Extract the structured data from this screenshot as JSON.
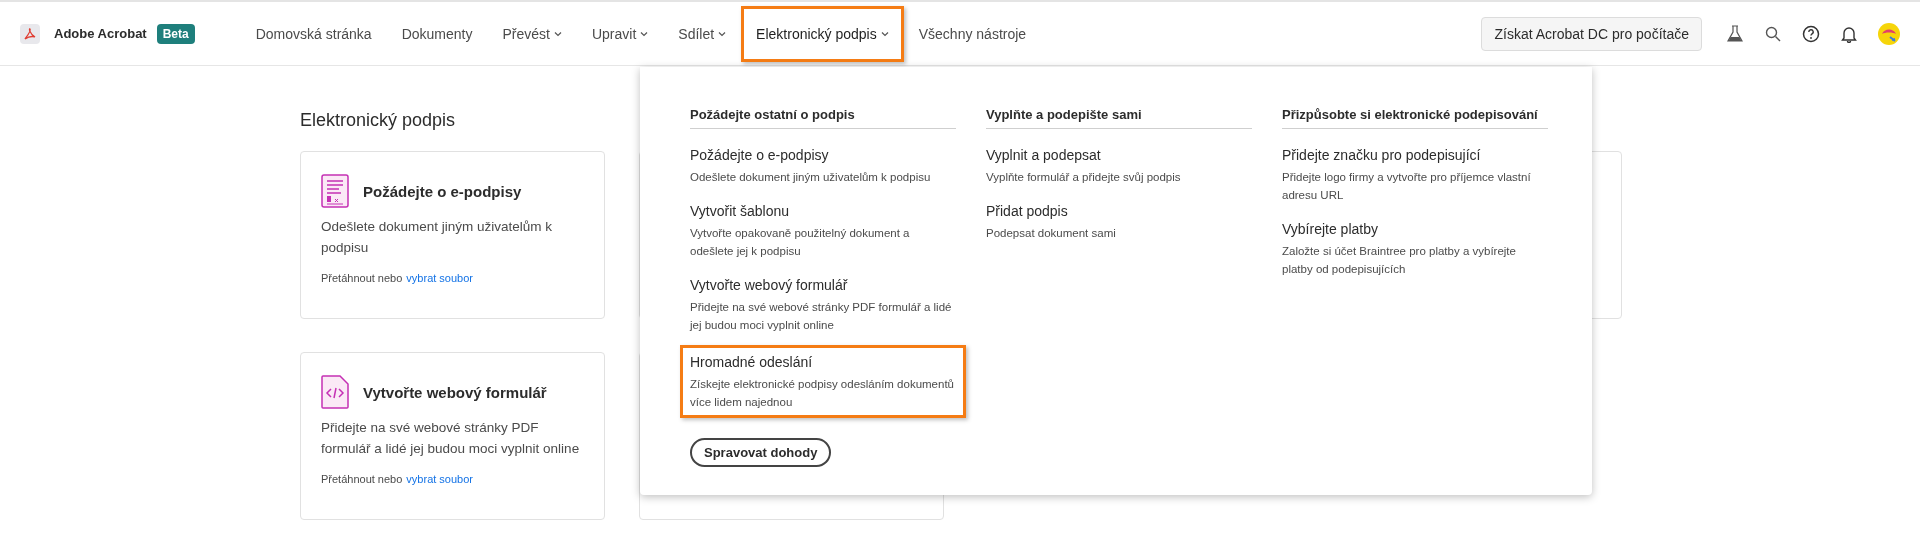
{
  "app": {
    "name": "Adobe Acrobat",
    "badge": "Beta"
  },
  "nav": [
    {
      "label": "Domovská stránka",
      "has_menu": false,
      "selected": false,
      "highlighted": false
    },
    {
      "label": "Dokumenty",
      "has_menu": false,
      "selected": false,
      "highlighted": false
    },
    {
      "label": "Převést",
      "has_menu": true,
      "selected": false,
      "highlighted": false
    },
    {
      "label": "Upravit",
      "has_menu": true,
      "selected": false,
      "highlighted": false
    },
    {
      "label": "Sdílet",
      "has_menu": true,
      "selected": false,
      "highlighted": false
    },
    {
      "label": "Elektronický podpis",
      "has_menu": true,
      "selected": true,
      "highlighted": true
    },
    {
      "label": "Všechny nástroje",
      "has_menu": false,
      "selected": false,
      "highlighted": false
    }
  ],
  "get_desktop_button": "Získat Acrobat DC pro počítače",
  "page_title": "Elektronický podpis",
  "cards": [
    {
      "kind": "sign",
      "title": "Požádejte o e-podpisy",
      "description": "Odešlete dokument jiným uživatelům k podpisu",
      "drop_text": "Přetáhnout nebo",
      "link": "vybrat soubor"
    },
    {
      "kind": "code",
      "title": "Vytvořte webový formulář",
      "description": "Přidejte na své webové stránky PDF formulář a lidé jej budou moci vyplnit online",
      "drop_text": "Přetáhnout nebo",
      "link": "vybrat soubor"
    }
  ],
  "menu": {
    "columns": [
      {
        "header": "Požádejte ostatní o podpis",
        "items": [
          {
            "title": "Požádejte o e-podpisy",
            "description": "Odešlete dokument jiným uživatelům k podpisu",
            "highlighted": false
          },
          {
            "title": "Vytvořit šablonu",
            "description": "Vytvořte opakovaně použitelný dokument a odešlete jej k podpisu",
            "highlighted": false
          },
          {
            "title": "Vytvořte webový formulář",
            "description": "Přidejte na své webové stránky PDF formulář a lidé jej budou moci vyplnit online",
            "highlighted": false
          },
          {
            "title": "Hromadné odeslání",
            "description": "Získejte elektronické podpisy odesláním dokumentů více lidem najednou",
            "highlighted": true
          }
        ],
        "button": "Spravovat dohody"
      },
      {
        "header": "Vyplňte a podepište sami",
        "items": [
          {
            "title": "Vyplnit a podepsat",
            "description": "Vyplňte formulář a přidejte svůj podpis",
            "highlighted": false
          },
          {
            "title": "Přidat podpis",
            "description": "Podepsat dokument sami",
            "highlighted": false
          }
        ]
      },
      {
        "header": "Přizpůsobte si elektronické podepisování",
        "items": [
          {
            "title": "Přidejte značku pro podepisující",
            "description": "Přidejte logo firmy a vytvořte pro příjemce vlastní adresu URL",
            "highlighted": false
          },
          {
            "title": "Vybírejte platby",
            "description": "Založte si účet Braintree pro platby a vybírejte platby od podepisujících",
            "highlighted": false
          }
        ]
      }
    ]
  }
}
